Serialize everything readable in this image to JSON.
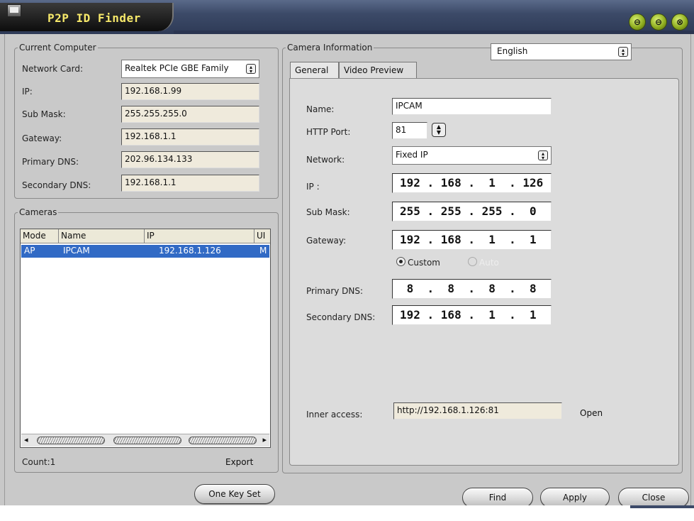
{
  "window": {
    "title": "P2P ID Finder",
    "controls": [
      "⊖",
      "⊖",
      "⊗"
    ]
  },
  "current_computer": {
    "legend": "Current Computer",
    "network_card_label": "Network Card:",
    "network_card_value": "Realtek PCIe GBE Family",
    "ip_label": "IP:",
    "ip_value": "192.168.1.99",
    "submask_label": "Sub Mask:",
    "submask_value": "255.255.255.0",
    "gateway_label": "Gateway:",
    "gateway_value": "192.168.1.1",
    "primary_dns_label": "Primary DNS:",
    "primary_dns_value": "202.96.134.133",
    "secondary_dns_label": "Secondary DNS:",
    "secondary_dns_value": "192.168.1.1"
  },
  "cameras": {
    "legend": "Cameras",
    "columns": [
      "Mode",
      "Name",
      "IP",
      "UI"
    ],
    "rows": [
      {
        "mode": "AP",
        "name": "IPCAM",
        "ip": "192.168.1.126",
        "ui": "M"
      }
    ],
    "count_label": "Count:1",
    "export_label": "Export"
  },
  "camera_info": {
    "legend": "Camera Information",
    "language": "English",
    "tabs": [
      "General",
      "Video Preview"
    ],
    "name_label": "Name:",
    "name_value": "IPCAM",
    "http_port_label": "HTTP Port:",
    "http_port_value": "81",
    "network_label": "Network:",
    "network_value": "Fixed IP",
    "ip_label": "IP :",
    "ip_value": "192 . 168 .  1  . 126",
    "submask_label": "Sub Mask:",
    "submask_value": "255 . 255 . 255 .  0",
    "gateway_label": "Gateway:",
    "gateway_value": "192 . 168 .  1  .  1",
    "custom_label": "Custom",
    "auto_label": "Auto",
    "primary_dns_label": "Primary DNS:",
    "primary_dns_value": " 8  .  8  .  8  .  8",
    "secondary_dns_label": "Secondary DNS:",
    "secondary_dns_value": "192 . 168 .  1  .  1",
    "inner_access_label": "Inner access:",
    "inner_access_value": "http://192.168.1.126:81",
    "open_label": "Open"
  },
  "buttons": {
    "one_key_set": "One Key Set",
    "find": "Find",
    "apply": "Apply",
    "close": "Close"
  }
}
